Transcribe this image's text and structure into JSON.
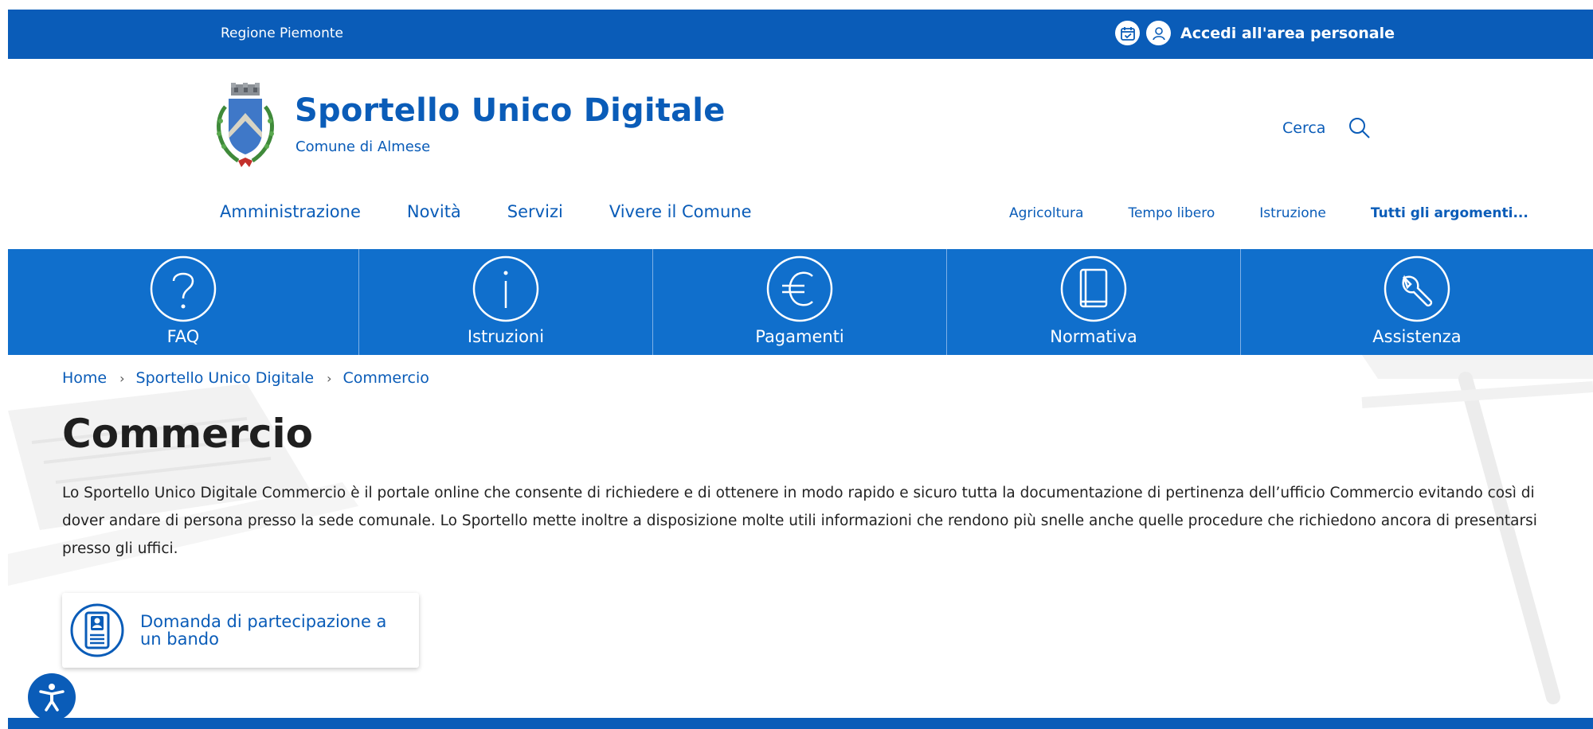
{
  "topbar": {
    "region": "Regione Piemonte",
    "login_label": "Accedi all'area personale",
    "calendar_icon": "calendar-check-icon",
    "user_icon": "user-icon"
  },
  "header": {
    "title": "Sportello Unico Digitale",
    "subtitle": "Comune di Almese",
    "search_label": "Cerca",
    "crest_icon": "municipal-crest-logo"
  },
  "nav_main": [
    "Amministrazione",
    "Novità",
    "Servizi",
    "Vivere il Comune"
  ],
  "nav_topics": [
    "Agricoltura",
    "Tempo libero",
    "Istruzione",
    "Tutti gli argomenti..."
  ],
  "tiles": [
    {
      "label": "FAQ",
      "icon": "question-icon"
    },
    {
      "label": "Istruzioni",
      "icon": "info-icon"
    },
    {
      "label": "Pagamenti",
      "icon": "euro-icon"
    },
    {
      "label": "Normativa",
      "icon": "book-icon"
    },
    {
      "label": "Assistenza",
      "icon": "wrench-icon"
    }
  ],
  "breadcrumb": [
    "Home",
    "Sportello Unico Digitale",
    "Commercio"
  ],
  "page": {
    "title": "Commercio",
    "description": "Lo Sportello Unico Digitale Commercio è il portale online che consente di richiedere e di ottenere in modo rapido e sicuro tutta la documentazione di pertinenza dell’ufficio Commercio evitando così di dover andare di persona presso la sede comunale. Lo Sportello mette inoltre a disposizione molte utili informazioni che rendono più snelle anche quelle procedure che richiedono ancora di presentarsi presso gli uffici."
  },
  "cards": [
    {
      "label": "Domanda di partecipazione a un bando",
      "icon": "application-form-icon"
    }
  ],
  "colors": {
    "primary": "#0a5cb8",
    "tile_bg": "#106fcc",
    "text": "#222222"
  }
}
